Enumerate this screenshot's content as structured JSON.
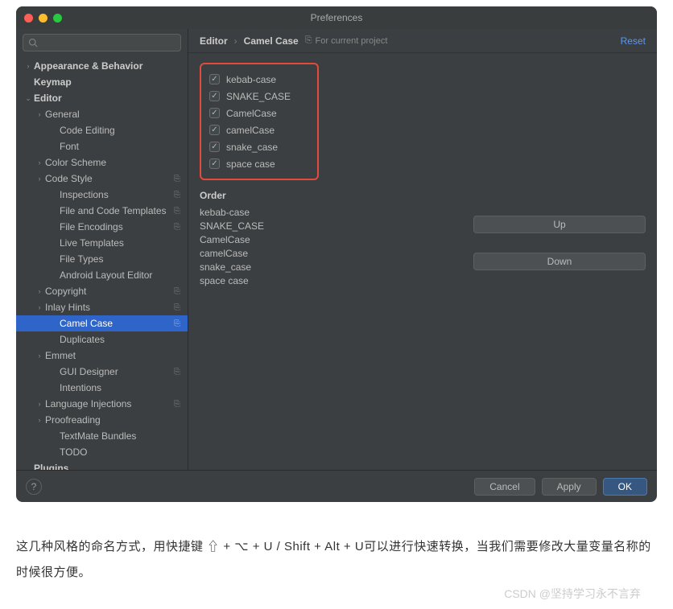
{
  "window": {
    "title": "Preferences"
  },
  "search": {
    "placeholder": ""
  },
  "tree": [
    {
      "label": "Appearance & Behavior",
      "level": 0,
      "arrow": "›",
      "bold": true
    },
    {
      "label": "Keymap",
      "level": 0,
      "arrow": "",
      "bold": true
    },
    {
      "label": "Editor",
      "level": 0,
      "arrow": "⌄",
      "bold": true
    },
    {
      "label": "General",
      "level": 1,
      "arrow": "›"
    },
    {
      "label": "Code Editing",
      "level": 2
    },
    {
      "label": "Font",
      "level": 2
    },
    {
      "label": "Color Scheme",
      "level": 1,
      "arrow": "›"
    },
    {
      "label": "Code Style",
      "level": 1,
      "arrow": "›",
      "badge": true
    },
    {
      "label": "Inspections",
      "level": 2,
      "badge": true
    },
    {
      "label": "File and Code Templates",
      "level": 2,
      "badge": true
    },
    {
      "label": "File Encodings",
      "level": 2,
      "badge": true
    },
    {
      "label": "Live Templates",
      "level": 2
    },
    {
      "label": "File Types",
      "level": 2
    },
    {
      "label": "Android Layout Editor",
      "level": 2
    },
    {
      "label": "Copyright",
      "level": 1,
      "arrow": "›",
      "badge": true
    },
    {
      "label": "Inlay Hints",
      "level": 1,
      "arrow": "›",
      "badge": true
    },
    {
      "label": "Camel Case",
      "level": 2,
      "badge": true,
      "selected": true
    },
    {
      "label": "Duplicates",
      "level": 2
    },
    {
      "label": "Emmet",
      "level": 1,
      "arrow": "›"
    },
    {
      "label": "GUI Designer",
      "level": 2,
      "badge": true
    },
    {
      "label": "Intentions",
      "level": 2
    },
    {
      "label": "Language Injections",
      "level": 1,
      "arrow": "›",
      "badge": true
    },
    {
      "label": "Proofreading",
      "level": 1,
      "arrow": "›"
    },
    {
      "label": "TextMate Bundles",
      "level": 2
    },
    {
      "label": "TODO",
      "level": 2
    },
    {
      "label": "Plugins",
      "level": 0,
      "arrow": "",
      "bold": true
    }
  ],
  "breadcrumb": {
    "root": "Editor",
    "leaf": "Camel Case",
    "scope": "For current project",
    "reset": "Reset"
  },
  "checks": [
    {
      "label": "kebab-case",
      "checked": true
    },
    {
      "label": "SNAKE_CASE",
      "checked": true
    },
    {
      "label": "CamelCase",
      "checked": true
    },
    {
      "label": "camelCase",
      "checked": true
    },
    {
      "label": "snake_case",
      "checked": true
    },
    {
      "label": "space case",
      "checked": true
    }
  ],
  "order": {
    "heading": "Order",
    "items": [
      "kebab-case",
      "SNAKE_CASE",
      "CamelCase",
      "camelCase",
      "snake_case",
      "space case"
    ],
    "up": "Up",
    "down": "Down"
  },
  "footer": {
    "cancel": "Cancel",
    "apply": "Apply",
    "ok": "OK",
    "help": "?"
  },
  "article": "这几种风格的命名方式，用快捷键 ⇧ + ⌥ + U / Shift + Alt + U可以进行快速转换，当我们需要修改大量变量名称的时候很方便。",
  "watermark": "CSDN @坚持学习永不言弃"
}
